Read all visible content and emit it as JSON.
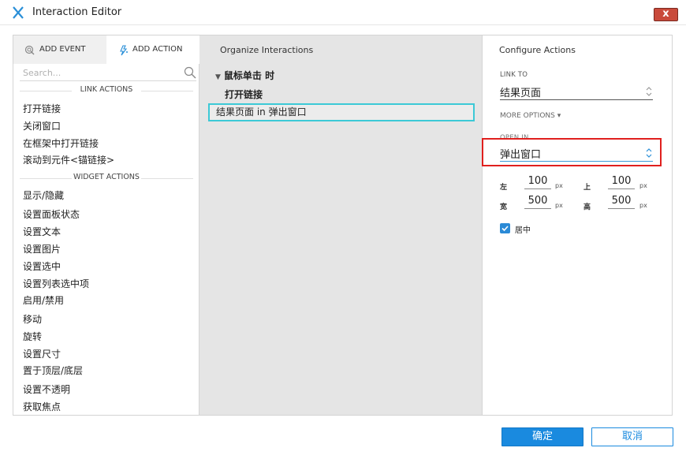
{
  "window": {
    "title": "Interaction Editor",
    "close_glyph": "x"
  },
  "tabs": {
    "add_event": "ADD EVENT",
    "add_action": "ADD ACTION"
  },
  "search": {
    "placeholder": "Search..."
  },
  "link_actions": {
    "header": "LINK ACTIONS",
    "items": [
      "打开链接",
      "关闭窗口",
      "在框架中打开链接",
      "滚动到元件<锚链接>"
    ]
  },
  "widget_actions": {
    "header": "WIDGET ACTIONS",
    "items": [
      "显示/隐藏",
      "设置面板状态",
      "设置文本",
      "设置图片",
      "设置选中",
      "设置列表选中项",
      "启用/禁用",
      "移动",
      "旋转",
      "设置尺寸",
      "置于顶层/底层",
      "设置不透明",
      "获取焦点"
    ]
  },
  "organize": {
    "title": "Organize Interactions",
    "event": "鼠标单击 时",
    "case": "打开链接",
    "action": "结果页面 in 弹出窗口"
  },
  "configure": {
    "title": "Configure Actions",
    "link_to_label": "LINK TO",
    "link_to_value": "结果页面",
    "more_options": "MORE OPTIONS ▾",
    "open_in_label": "OPEN IN",
    "open_in_value": "弹出窗口",
    "geometry": {
      "left_label": "左",
      "left_value": "100",
      "top_label": "上",
      "top_value": "100",
      "width_label": "宽",
      "width_value": "500",
      "height_label": "高",
      "height_value": "500",
      "unit": "px"
    },
    "center_label": "居中",
    "center_checked": true
  },
  "footer": {
    "ok": "确定",
    "cancel": "取消"
  },
  "colors": {
    "accent": "#1a8adf",
    "selection": "#3cc9d6",
    "highlight": "#e0201e",
    "close": "#c94a3b"
  }
}
